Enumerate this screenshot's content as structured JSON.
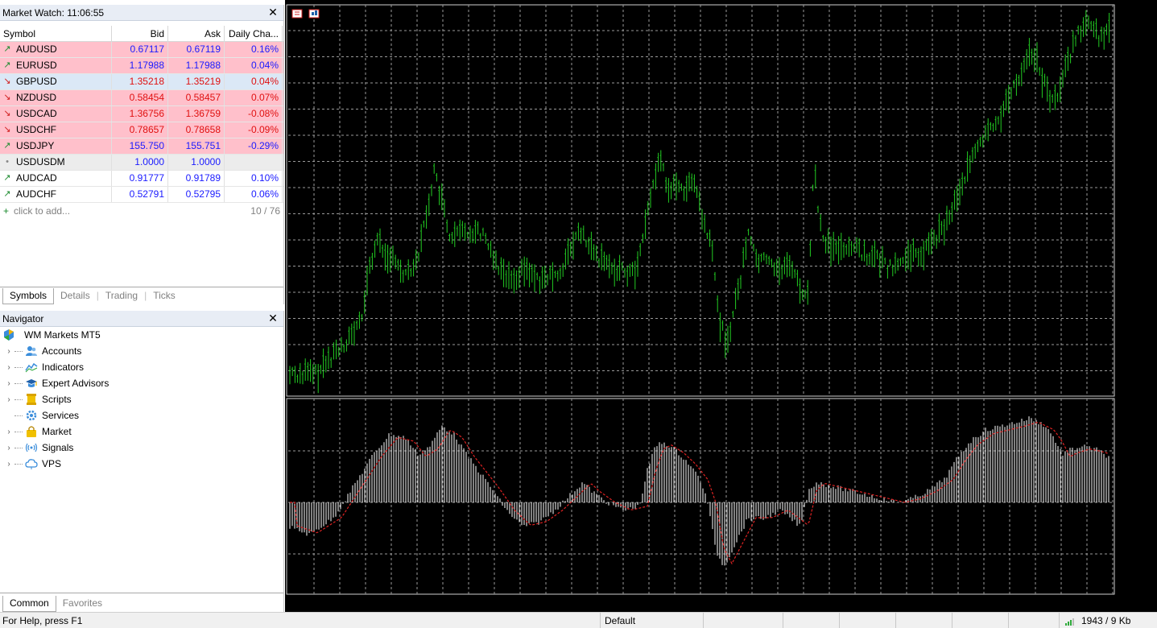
{
  "market_watch": {
    "title": "Market Watch: 11:06:55",
    "columns": {
      "symbol": "Symbol",
      "bid": "Bid",
      "ask": "Ask",
      "change": "Daily Cha..."
    },
    "rows": [
      {
        "symbol": "AUDUSD",
        "bid": "0.67117",
        "ask": "0.67119",
        "change": "0.16%",
        "dir": "up",
        "bg": "pink",
        "color": "blue"
      },
      {
        "symbol": "EURUSD",
        "bid": "1.17988",
        "ask": "1.17988",
        "change": "0.04%",
        "dir": "up",
        "bg": "pink",
        "color": "blue"
      },
      {
        "symbol": "GBPUSD",
        "bid": "1.35218",
        "ask": "1.35219",
        "change": "0.04%",
        "dir": "down",
        "bg": "blue",
        "color": "red"
      },
      {
        "symbol": "NZDUSD",
        "bid": "0.58454",
        "ask": "0.58457",
        "change": "0.07%",
        "dir": "down",
        "bg": "pink",
        "color": "red"
      },
      {
        "symbol": "USDCAD",
        "bid": "1.36756",
        "ask": "1.36759",
        "change": "-0.08%",
        "dir": "down",
        "bg": "pink",
        "color": "red"
      },
      {
        "symbol": "USDCHF",
        "bid": "0.78657",
        "ask": "0.78658",
        "change": "-0.09%",
        "dir": "down",
        "bg": "pink",
        "color": "red"
      },
      {
        "symbol": "USDJPY",
        "bid": "155.750",
        "ask": "155.751",
        "change": "-0.29%",
        "dir": "up",
        "bg": "pink",
        "color": "blue"
      },
      {
        "symbol": "USDUSDM",
        "bid": "1.0000",
        "ask": "1.0000",
        "change": "",
        "dir": "neutral",
        "bg": "grey",
        "color": "blue"
      },
      {
        "symbol": "AUDCAD",
        "bid": "0.91777",
        "ask": "0.91789",
        "change": "0.10%",
        "dir": "up",
        "bg": "white",
        "color": "blue"
      },
      {
        "symbol": "AUDCHF",
        "bid": "0.52791",
        "ask": "0.52795",
        "change": "0.06%",
        "dir": "up",
        "bg": "white",
        "color": "blue"
      }
    ],
    "add_label": "click to add...",
    "count": "10 / 76",
    "tabs": [
      "Symbols",
      "Details",
      "Trading",
      "Ticks"
    ]
  },
  "navigator": {
    "title": "Navigator",
    "root": "WM Markets MT5",
    "items": [
      {
        "label": "Accounts",
        "icon": "accounts-icon",
        "expandable": true
      },
      {
        "label": "Indicators",
        "icon": "indicators-icon",
        "expandable": true
      },
      {
        "label": "Expert Advisors",
        "icon": "expert-advisors-icon",
        "expandable": true
      },
      {
        "label": "Scripts",
        "icon": "scripts-icon",
        "expandable": true
      },
      {
        "label": "Services",
        "icon": "services-icon",
        "expandable": false
      },
      {
        "label": "Market",
        "icon": "market-icon",
        "expandable": true
      },
      {
        "label": "Signals",
        "icon": "signals-icon",
        "expandable": true
      },
      {
        "label": "VPS",
        "icon": "vps-icon",
        "expandable": true
      }
    ],
    "tabs": [
      "Common",
      "Favorites"
    ]
  },
  "status_bar": {
    "help": "For Help, press F1",
    "profile": "Default",
    "traffic": "1943 / 9 Kb"
  },
  "colors": {
    "chart_bg": "#000000",
    "candle": "#22cc22",
    "grid": "#9a9a9a",
    "histogram": "#ffffff",
    "signal_line": "#dd2222",
    "row_pink": "#ffc0cb",
    "row_blue": "#dbe8f6"
  }
}
